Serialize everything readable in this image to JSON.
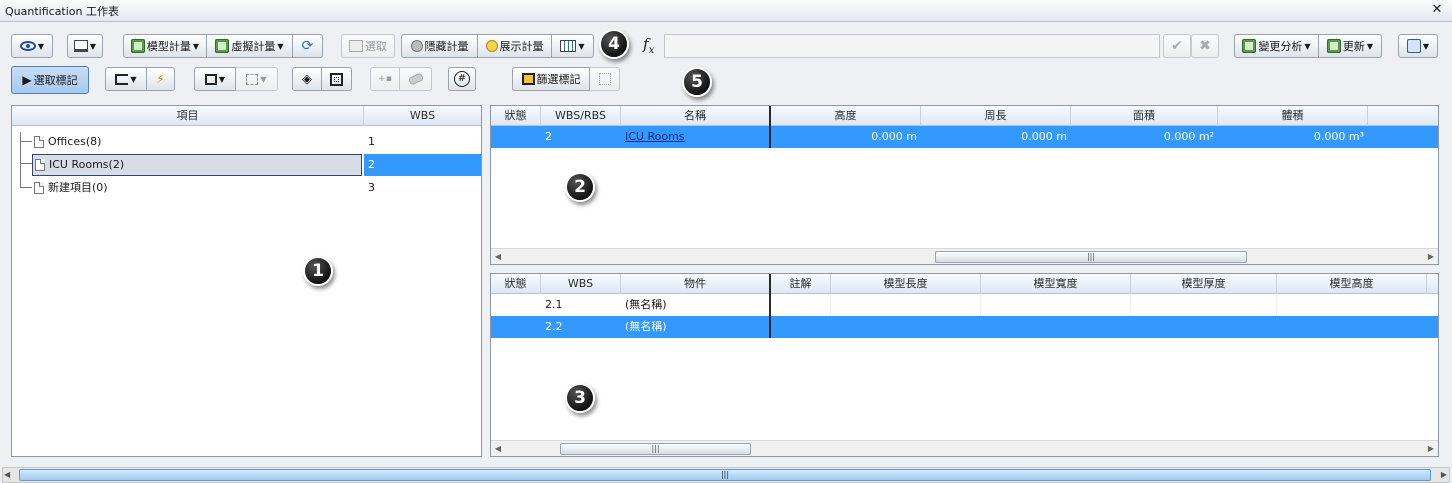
{
  "window": {
    "title": "Quantification 工作表",
    "close_glyph": "✕"
  },
  "toolbar": {
    "model_takeoff": "模型計量",
    "virtual_takeoff": "虛擬計量",
    "select": "選取",
    "hide_takeoff": "隱藏計量",
    "show_takeoff": "展示計量",
    "change_analysis": "變更分析",
    "update": "更新",
    "select_mark": "選取標記",
    "filter_mark": "篩選標記",
    "fx_label": "f",
    "fx_sub": "x",
    "hash": "#",
    "minus_plus": "+▪"
  },
  "callouts": [
    "1",
    "2",
    "3",
    "4",
    "5"
  ],
  "tree": {
    "columns": [
      "項目",
      "WBS"
    ],
    "rows": [
      {
        "name": "Offices(8)",
        "wbs": "1"
      },
      {
        "name": "ICU Rooms(2)",
        "wbs": "2"
      },
      {
        "name": "新建項目(0)",
        "wbs": "3"
      }
    ]
  },
  "upper_grid": {
    "columns": [
      "狀態",
      "WBS/RBS",
      "名稱",
      "高度",
      "周長",
      "面積",
      "體積"
    ],
    "rows": [
      {
        "status": "",
        "wbs": "2",
        "name": "ICU Rooms",
        "height": "0.000 m",
        "perimeter": "0.000 m",
        "area": "0.000 m²",
        "volume": "0.000 m³"
      }
    ]
  },
  "lower_grid": {
    "columns": [
      "狀態",
      "WBS",
      "物件",
      "註解",
      "模型長度",
      "模型寬度",
      "模型厚度",
      "模型高度"
    ],
    "rows": [
      {
        "status": "",
        "wbs": "2.1",
        "object": "(無名稱)"
      },
      {
        "status": "",
        "wbs": "2.2",
        "object": "(無名稱)"
      }
    ]
  },
  "scroll_grip": "|||",
  "colors": {
    "selection": "#3399ff",
    "link": "#0a3ea8"
  }
}
